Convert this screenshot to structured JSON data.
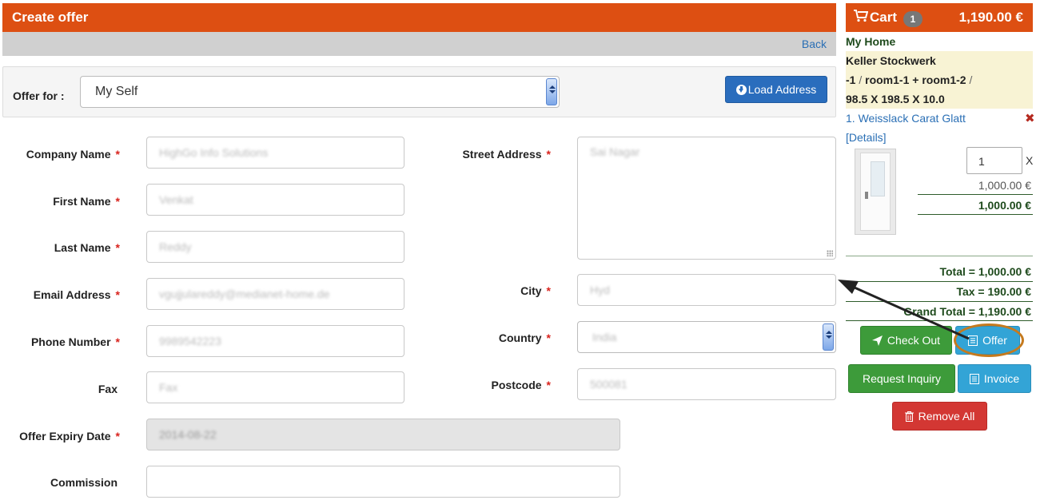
{
  "header": {
    "title": "Create offer",
    "back_label": "Back"
  },
  "offer_for": {
    "label": "Offer for :",
    "selected": "My Self",
    "load_address_label": "Load Address"
  },
  "form": {
    "company_name": {
      "label": "Company Name",
      "value": "HighGo Info Solutions"
    },
    "first_name": {
      "label": "First Name",
      "value": "Venkat"
    },
    "last_name": {
      "label": "Last Name",
      "value": "Reddy"
    },
    "email": {
      "label": "Email Address",
      "value": "vgujjulareddy@medianet-home.de"
    },
    "phone": {
      "label": "Phone Number",
      "value": "9989542223"
    },
    "fax": {
      "label": "Fax",
      "value": "Fax"
    },
    "expiry": {
      "label": "Offer Expiry Date",
      "value": "2014-08-22"
    },
    "commission": {
      "label": "Commission",
      "value": ""
    },
    "street": {
      "label": "Street Address",
      "value": "Sai Nagar"
    },
    "city": {
      "label": "City",
      "value": "Hyd"
    },
    "country": {
      "label": "Country",
      "value": "India"
    },
    "postcode": {
      "label": "Postcode",
      "value": "500081"
    },
    "required_mark": "*"
  },
  "cart": {
    "label": "Cart",
    "count": "1",
    "total": "1,190.00 €",
    "home": "My Home",
    "floor": "Keller Stockwerk",
    "rooms_part1": "-1",
    "rooms_part2": "room1-1 + room1-2",
    "sep": "/",
    "dimensions": "98.5 X 198.5 X 10.0",
    "product": "1. Weisslack Carat Glatt",
    "details": "[Details]",
    "remove": "✖",
    "quantity": "1",
    "qty_x": "X",
    "unit_price": "1,000.00 €",
    "line_total": "1,000.00 €",
    "sum_total": "Total = 1,000.00 €",
    "sum_tax": "Tax = 190.00 €",
    "sum_grand": "Grand Total = 1,190.00 €",
    "checkout_label": "Check Out",
    "offer_label": "Offer",
    "inquiry_label": "Request Inquiry",
    "invoice_label": "Invoice",
    "remove_all_label": "Remove All"
  },
  "colors": {
    "header": "#dd4f12",
    "link": "#2a6fb5",
    "success": "#3d9b3a",
    "info": "#33a4d6",
    "danger": "#d33733",
    "annotation": "#c57a1e"
  }
}
